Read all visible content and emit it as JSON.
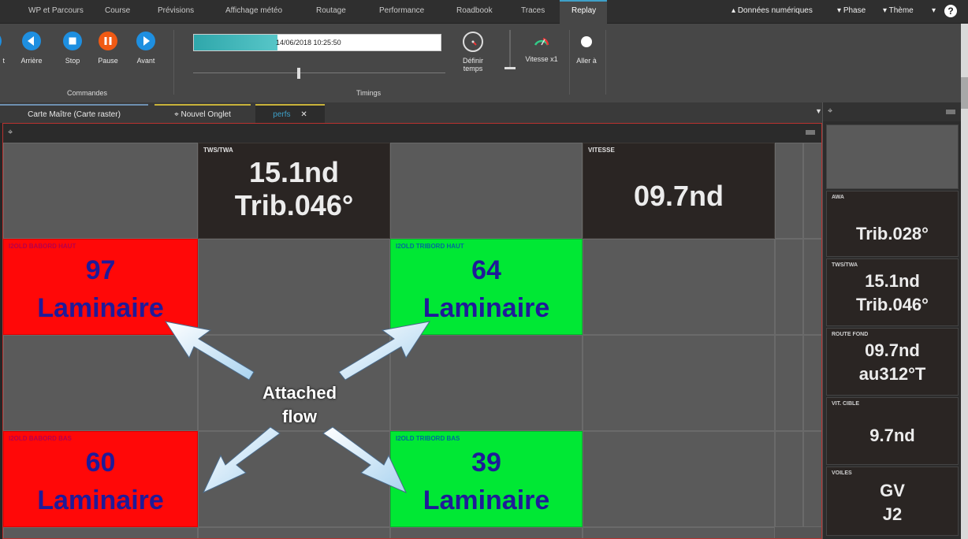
{
  "menu": {
    "items": [
      "WP et Parcours",
      "Course",
      "Prévisions",
      "Affichage météo",
      "Routage",
      "Performance",
      "Roadbook",
      "Traces",
      "Replay"
    ],
    "right": [
      "Données numériques",
      "Phase",
      "Thème"
    ],
    "help": "?"
  },
  "ribbon": {
    "commands": {
      "label": "Commandes",
      "buttons": [
        "Arrière",
        "Stop",
        "Pause",
        "Avant"
      ]
    },
    "timings": {
      "label": "Timings",
      "time": "14/06/2018 10:25:50",
      "progress": 0.34,
      "slider": 0.42,
      "define_time": "Définir temps",
      "speed": "Vitesse x1",
      "goto": "Aller à"
    }
  },
  "tabs": [
    {
      "label": "Carte Maître (Carte raster)"
    },
    {
      "label": "Nouvel Onglet"
    },
    {
      "label": "perfs",
      "close": "✕"
    }
  ],
  "panels": {
    "tws_twa": {
      "title": "TWS/TWA",
      "line1": "15.1nd",
      "line2": "Trib.046°"
    },
    "vitesse": {
      "title": "VITESSE",
      "value": "09.7nd"
    },
    "baboard_haut": {
      "title": "I2OLD BABORD HAUT",
      "line1": "97",
      "line2": "Laminaire"
    },
    "tribord_haut": {
      "title": "I2OLD TRIBORD HAUT",
      "line1": "64",
      "line2": "Laminaire"
    },
    "baboard_bas": {
      "title": "I2OLD BABORD BAS",
      "line1": "60",
      "line2": "Laminaire"
    },
    "tribord_bas": {
      "title": "I2OLD TRIBORD BAS",
      "line1": "39",
      "line2": "Laminaire"
    }
  },
  "annotation": {
    "line1": "Attached",
    "line2": "flow"
  },
  "side": {
    "awa": {
      "title": "AWA",
      "value": "Trib.028°"
    },
    "tws_twa": {
      "title": "TWS/TWA",
      "line1": "15.1nd",
      "line2": "Trib.046°"
    },
    "route_fond": {
      "title": "ROUTE FOND",
      "line1": "09.7nd",
      "line2": "au312°T"
    },
    "vit_cible": {
      "title": "VIT. CIBLE",
      "value": "9.7nd"
    },
    "voiles": {
      "title": "VOILES",
      "line1": "GV",
      "line2": "J2"
    }
  },
  "colors": {
    "red_panel": "#ff0808",
    "green_panel": "#00e834",
    "value_text": "#1f1a99",
    "accent": "#3ea0c8"
  }
}
